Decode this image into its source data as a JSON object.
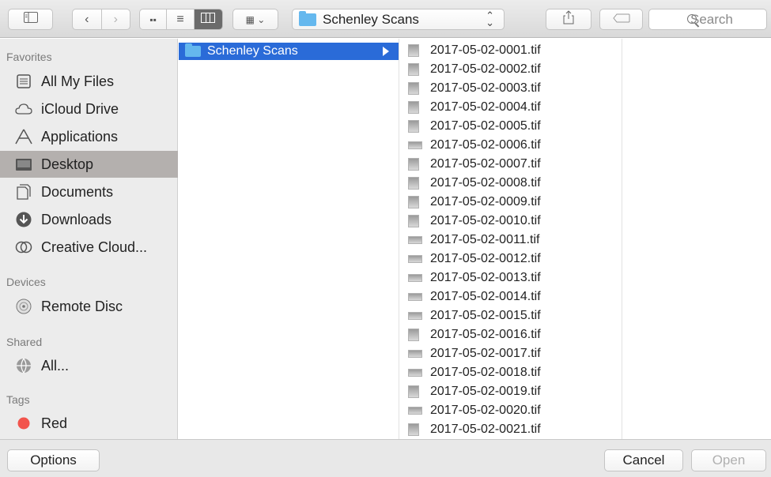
{
  "toolbar": {
    "location": "Schenley Scans",
    "search_placeholder": "Search"
  },
  "sidebar": {
    "sections": [
      {
        "label": "Favorites",
        "items": [
          {
            "label": "All My Files",
            "icon": "all-files-icon"
          },
          {
            "label": "iCloud Drive",
            "icon": "cloud-icon"
          },
          {
            "label": "Applications",
            "icon": "applications-icon"
          },
          {
            "label": "Desktop",
            "icon": "desktop-icon",
            "selected": true
          },
          {
            "label": "Documents",
            "icon": "documents-icon"
          },
          {
            "label": "Downloads",
            "icon": "downloads-icon"
          },
          {
            "label": "Creative Cloud...",
            "icon": "creative-cloud-icon"
          }
        ]
      },
      {
        "label": "Devices",
        "items": [
          {
            "label": "Remote Disc",
            "icon": "disc-icon"
          }
        ]
      },
      {
        "label": "Shared",
        "items": [
          {
            "label": "All...",
            "icon": "network-icon"
          }
        ]
      },
      {
        "label": "Tags",
        "items": [
          {
            "label": "Red",
            "icon": "red-tag-icon"
          }
        ]
      }
    ]
  },
  "column1": {
    "selected_folder": "Schenley Scans"
  },
  "column2": {
    "files": [
      "2017-05-02-0001.tif",
      "2017-05-02-0002.tif",
      "2017-05-02-0003.tif",
      "2017-05-02-0004.tif",
      "2017-05-02-0005.tif",
      "2017-05-02-0006.tif",
      "2017-05-02-0007.tif",
      "2017-05-02-0008.tif",
      "2017-05-02-0009.tif",
      "2017-05-02-0010.tif",
      "2017-05-02-0011.tif",
      "2017-05-02-0012.tif",
      "2017-05-02-0013.tif",
      "2017-05-02-0014.tif",
      "2017-05-02-0015.tif",
      "2017-05-02-0016.tif",
      "2017-05-02-0017.tif",
      "2017-05-02-0018.tif",
      "2017-05-02-0019.tif",
      "2017-05-02-0020.tif",
      "2017-05-02-0021.tif"
    ]
  },
  "bottom": {
    "options_label": "Options",
    "cancel_label": "Cancel",
    "open_label": "Open"
  },
  "colors": {
    "selection": "#2a6bd8",
    "sidebar_bg": "#ececec",
    "sidebar_selected": "#b4b0ae",
    "folder": "#65b8ee",
    "red_tag": "#f2544c"
  }
}
